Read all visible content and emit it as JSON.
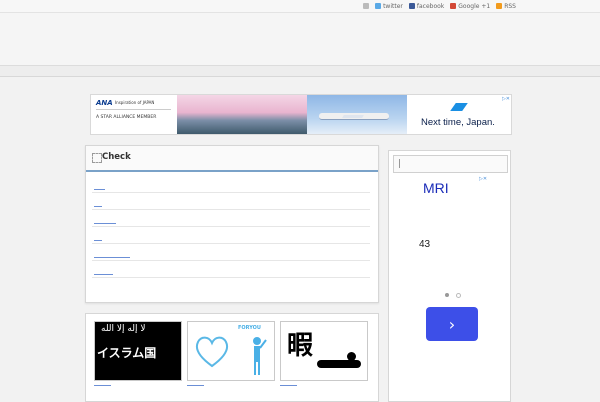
{
  "topbar": {
    "links": [
      {
        "label": "twitter",
        "icon": "twitter-icon",
        "color": "#5aa9e6"
      },
      {
        "label": "facebook",
        "icon": "facebook-icon",
        "color": "#3b5998"
      },
      {
        "label": "Google +1",
        "icon": "google-plus-icon",
        "color": "#d34836"
      },
      {
        "label": "RSS",
        "icon": "rss-icon",
        "color": "#f29b1d"
      }
    ]
  },
  "banner": {
    "brand": "ANA",
    "tagline": "Inspiration of JAPAN",
    "alliance": "A STAR ALLIANCE MEMBER",
    "headline": "Next time, Japan."
  },
  "check_panel": {
    "title": "Check",
    "rows": 6
  },
  "cards": [
    {
      "name": "islamic-state-card",
      "text": "イスラム国",
      "arabic": "لا إله إلا الله"
    },
    {
      "name": "whiteday-card",
      "text": "FORYOU",
      "subtext": "WHITEDAY"
    },
    {
      "name": "hima-card",
      "text": "暇"
    }
  ],
  "sidebar_ad": {
    "title": "MRI",
    "number": "43",
    "button_symbol": "›"
  },
  "colors": {
    "accent": "#7aa2c8",
    "link": "#6b8fd6",
    "ad_button": "#3d4fe8"
  }
}
